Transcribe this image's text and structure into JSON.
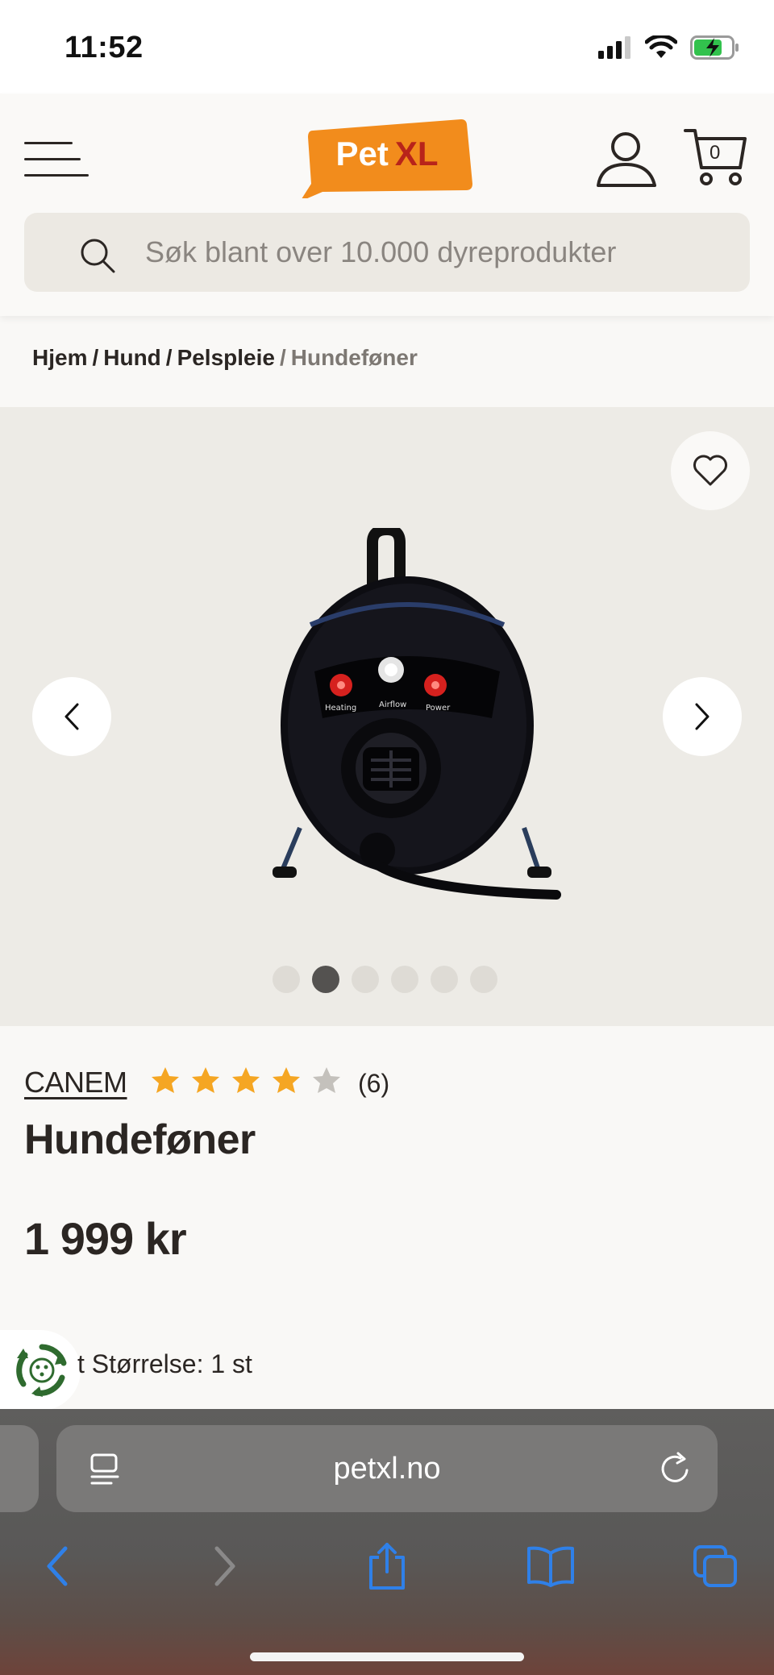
{
  "status_bar": {
    "time": "11:52"
  },
  "header": {
    "logo": {
      "word1": "Pet",
      "word2": "XL"
    },
    "cart_count": "0",
    "search": {
      "placeholder": "Søk blant over 10.000 dyreprodukter",
      "value": ""
    }
  },
  "breadcrumb": {
    "items": [
      "Hjem",
      "Hund",
      "Pelspleie"
    ],
    "current": "Hundeføner",
    "separator": "/"
  },
  "gallery": {
    "image_count": 6,
    "active_index": 1,
    "product_labels": [
      "Heating",
      "Airflow",
      "Power"
    ]
  },
  "product": {
    "brand": "CANEM",
    "rating": 4,
    "rating_max": 5,
    "review_count": "(6)",
    "title": "Hundeføner",
    "price": "1 999 kr",
    "size_text": "t Størrelse: 1 st"
  },
  "browser": {
    "url": "petxl.no"
  },
  "colors": {
    "brand_orange": "#f28c1c",
    "brand_red": "#b8241a",
    "star_filled": "#f5a623",
    "star_empty": "#c4c1bc",
    "ios_blue": "#2f80e8",
    "eco_green": "#2f6b2f"
  },
  "icons": {
    "menu": "hamburger-icon",
    "account": "user-icon",
    "cart": "cart-icon",
    "search": "search-icon",
    "favorite": "heart-icon",
    "prev": "chevron-left-icon",
    "next": "chevron-right-icon",
    "back": "back-arrow-icon",
    "forward": "forward-arrow-icon",
    "share": "share-icon",
    "bookmarks": "book-icon",
    "tabs": "tabs-icon",
    "reload": "reload-icon",
    "reader": "reader-icon",
    "eco": "eco-recycle-icon"
  }
}
